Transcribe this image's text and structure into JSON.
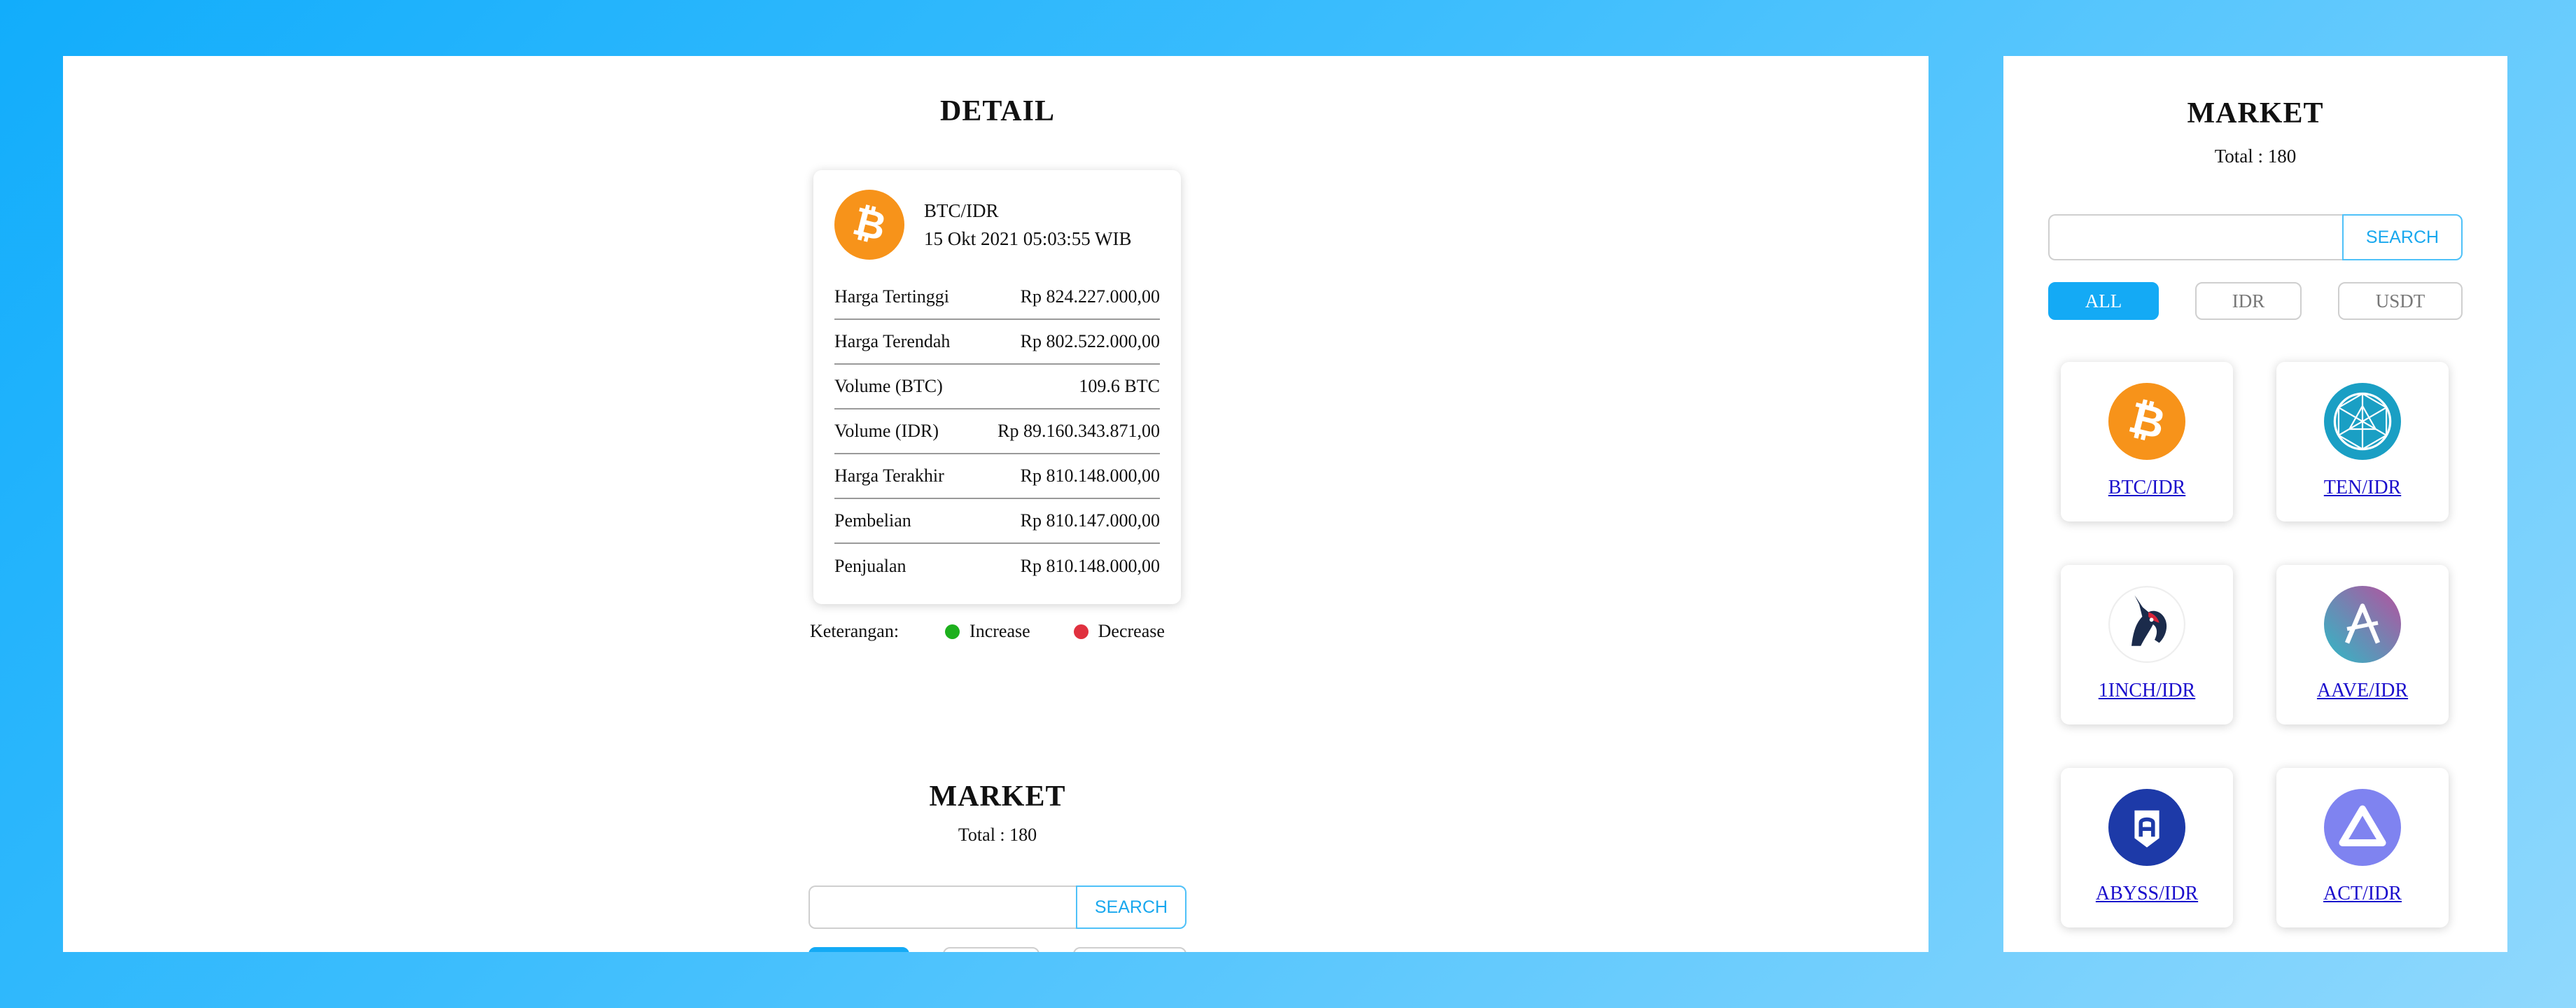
{
  "detail": {
    "title": "DETAIL",
    "pair": "BTC/IDR",
    "timestamp": "15 Okt 2021 05:03:55 WIB",
    "rows": [
      {
        "label": "Harga Tertinggi",
        "value": "Rp 824.227.000,00"
      },
      {
        "label": "Harga Terendah",
        "value": "Rp 802.522.000,00"
      },
      {
        "label": "Volume (BTC)",
        "value": "109.6 BTC"
      },
      {
        "label": "Volume (IDR)",
        "value": "Rp 89.160.343.871,00"
      },
      {
        "label": "Harga Terakhir",
        "value": "Rp 810.148.000,00"
      },
      {
        "label": "Pembelian",
        "value": "Rp 810.147.000,00"
      },
      {
        "label": "Penjualan",
        "value": "Rp 810.148.000,00"
      }
    ],
    "legend": {
      "label": "Keterangan:",
      "increase": "Increase",
      "decrease": "Decrease",
      "increase_color": "#1db01d",
      "decrease_color": "#e0313f"
    }
  },
  "market": {
    "title": "MARKET",
    "total": "Total : 180",
    "search_label": "SEARCH",
    "search_value": "",
    "filters": [
      "ALL",
      "IDR",
      "USDT"
    ],
    "active_filter": "ALL",
    "items": [
      {
        "pair": "BTC/IDR",
        "icon": "bitcoin-icon"
      },
      {
        "pair": "TEN/IDR",
        "icon": "tokenomy-icon"
      },
      {
        "pair": "1INCH/IDR",
        "icon": "1inch-unicorn-icon"
      },
      {
        "pair": "AAVE/IDR",
        "icon": "aave-icon"
      },
      {
        "pair": "ABYSS/IDR",
        "icon": "abyss-icon"
      },
      {
        "pair": "ACT/IDR",
        "icon": "achain-icon"
      }
    ]
  },
  "colors": {
    "accent": "#14aaf5",
    "bitcoin": "#f7931a",
    "link": "#1a0dcc"
  }
}
